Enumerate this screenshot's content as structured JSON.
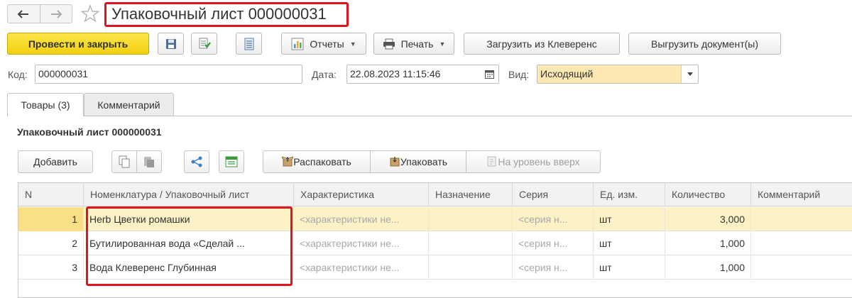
{
  "header": {
    "title": "Упаковочный лист 000000031",
    "back_icon": "arrow-left-icon",
    "forward_icon": "arrow-right-icon",
    "favorite_icon": "star-icon"
  },
  "toolbar": {
    "post_close": "Провести и закрыть",
    "reports": "Отчеты",
    "print": "Печать",
    "load_cleverence": "Загрузить из Клеверенс",
    "export_docs": "Выгрузить документ(ы)"
  },
  "fields": {
    "code_label": "Код:",
    "code_value": "000000031",
    "date_label": "Дата:",
    "date_value": "22.08.2023 11:15:46",
    "kind_label": "Вид:",
    "kind_value": "Исходящий"
  },
  "tabs": [
    {
      "label": "Товары (3)",
      "active": true
    },
    {
      "label": "Комментарий",
      "active": false
    }
  ],
  "section": {
    "title": "Упаковочный лист 000000031"
  },
  "table_toolbar": {
    "add": "Добавить",
    "unpack": "Распаковать",
    "pack": "Упаковать",
    "level_up": "На уровень вверх"
  },
  "table": {
    "columns": [
      "N",
      "Номенклатура / Упаковочный лист",
      "Характеристика",
      "Назначение",
      "Серия",
      "Ед. изм.",
      "Количество",
      "Комментарий"
    ],
    "rows": [
      {
        "n": "1",
        "item": "Herb Цветки ромашки",
        "characteristic": "<характеристики не...",
        "purpose": "",
        "series": "<серия н...",
        "unit": "шт",
        "qty": "3,000",
        "comment": ""
      },
      {
        "n": "2",
        "item": "Бутилированная вода «Сделай ...",
        "characteristic": "<характеристики не...",
        "purpose": "",
        "series": "<серия н...",
        "unit": "шт",
        "qty": "1,000",
        "comment": ""
      },
      {
        "n": "3",
        "item": "Вода Клеверенс Глубинная",
        "characteristic": "<характеристики не...",
        "purpose": "",
        "series": "<серия н...",
        "unit": "шт",
        "qty": "1,000",
        "comment": ""
      }
    ],
    "selected_row": 1
  },
  "colors": {
    "highlight_border": "#e0141e",
    "primary_button": "#f5d614",
    "selected_row": "#fcf2c6",
    "select_field": "#fde8b3"
  }
}
